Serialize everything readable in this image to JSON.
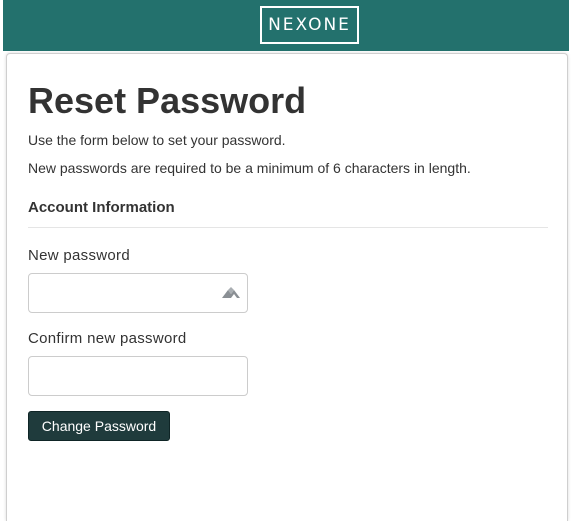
{
  "header": {
    "logo_text": "NEXONE",
    "bg_color": "#23716d"
  },
  "page": {
    "title": "Reset Password",
    "intro_1": "Use the form below to set your password.",
    "intro_2": "New passwords are required to be a minimum of 6 characters in length."
  },
  "form": {
    "section_title": "Account Information",
    "new_password": {
      "label": "New password",
      "value": "",
      "icon": "password-manager-icon"
    },
    "confirm_password": {
      "label": "Confirm new password",
      "value": ""
    },
    "submit_label": "Change Password",
    "submit_color": "#1f3b3c"
  }
}
